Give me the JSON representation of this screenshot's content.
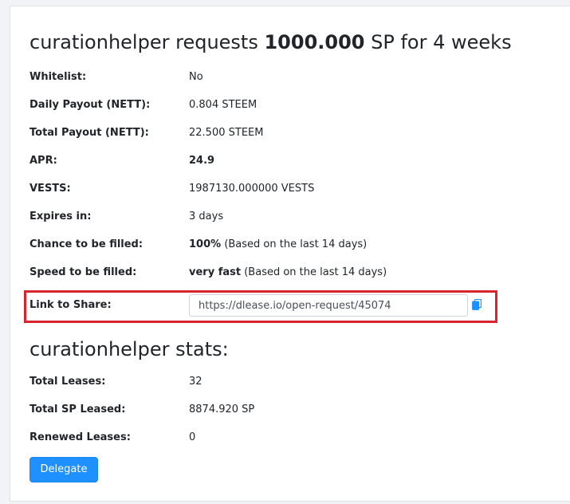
{
  "request": {
    "user": "curationhelper",
    "requests_text": "requests",
    "amount": "1000.000",
    "unit_duration": "SP for 4 weeks"
  },
  "details": [
    {
      "label": "Whitelist:",
      "value": "No"
    },
    {
      "label": "Daily Payout (NETT):",
      "value": "0.804 STEEM"
    },
    {
      "label": "Total Payout (NETT):",
      "value": "22.500 STEEM"
    },
    {
      "label": "APR:",
      "value": "24.9"
    },
    {
      "label": "VESTS:",
      "value": "1987130.000000 VESTS"
    },
    {
      "label": "Expires in:",
      "value": "3 days"
    },
    {
      "label": "Chance to be filled:",
      "value_strong": "100%",
      "value_rest": "(Based on the last 14 days)"
    },
    {
      "label": "Speed to be filled:",
      "value_strong": "very fast",
      "value_rest": "(Based on the last 14 days)"
    }
  ],
  "share": {
    "label": "Link to Share:",
    "url": "https://dlease.io/open-request/45074",
    "copy_icon": "clipboard-icon",
    "highlight_color": "#d9232e"
  },
  "stats": {
    "title": "curationhelper stats:",
    "rows": [
      {
        "label": "Total Leases:",
        "value": "32"
      },
      {
        "label": "Total SP Leased:",
        "value": "8874.920 SP"
      },
      {
        "label": "Renewed Leases:",
        "value": "0"
      }
    ]
  },
  "actions": {
    "delegate_label": "Delegate",
    "button_color": "#1e90ff"
  }
}
